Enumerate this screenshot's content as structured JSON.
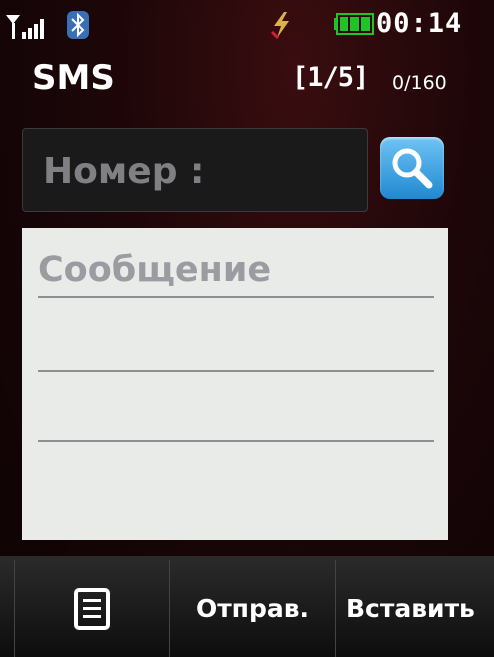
{
  "status_bar": {
    "signal_icon": "signal-strength-icon",
    "bluetooth_icon": "bluetooth-icon",
    "charging_icon": "charging-icon",
    "battery_icon": "battery-full-icon",
    "time": "00:14",
    "battery_color": "#22c22a"
  },
  "header": {
    "title": "SMS",
    "page_indicator": "[1/5]",
    "char_counter": "0/160"
  },
  "number_field": {
    "label": "Номер :",
    "value": ""
  },
  "search_button": {
    "icon": "search-icon",
    "color": "#2f9be0"
  },
  "message": {
    "placeholder": "Сообщение",
    "value": ""
  },
  "softkeys": {
    "menu_icon": "menu-list-icon",
    "send_label": "Отправ.",
    "paste_label": "Вставить"
  }
}
